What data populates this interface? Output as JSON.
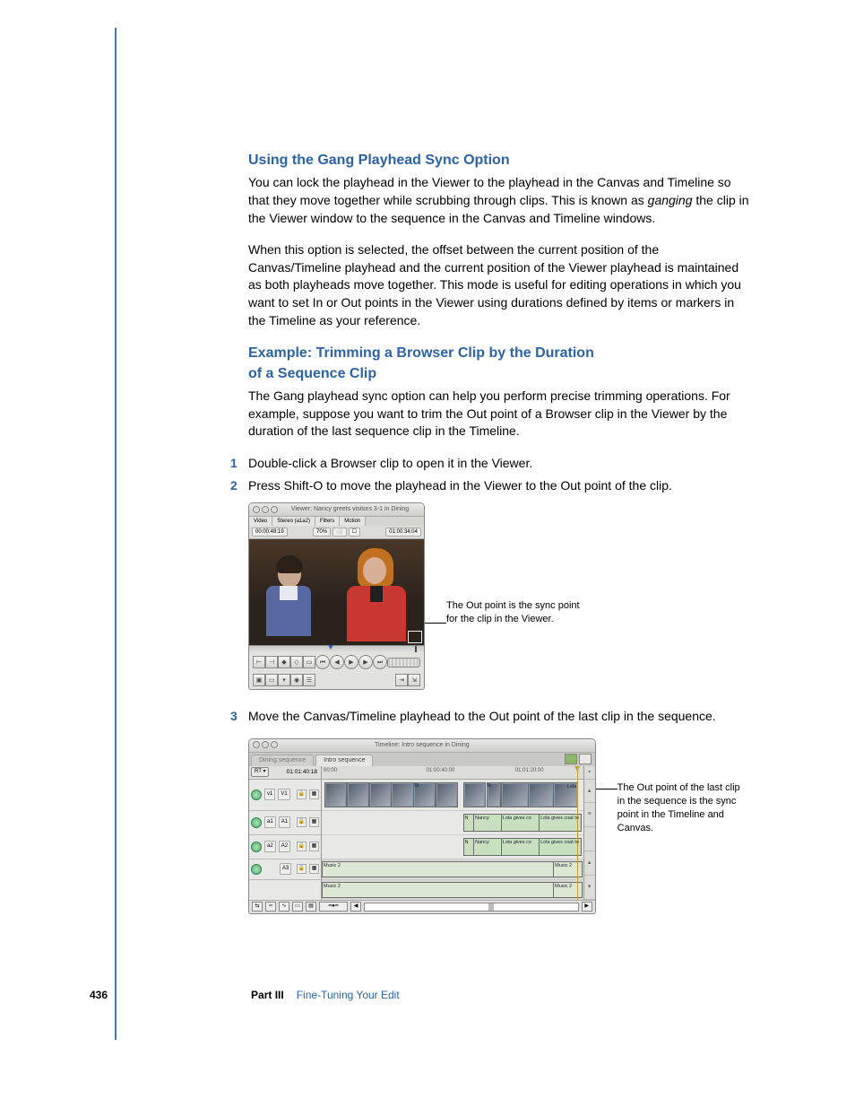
{
  "headings": {
    "h1": "Using the Gang Playhead Sync Option",
    "h2_line1": "Example:  Trimming a Browser Clip by the Duration",
    "h2_line2": "of a Sequence Clip"
  },
  "paragraphs": {
    "p1a": "You can lock the playhead in the Viewer to the playhead in the Canvas and Timeline so that they move together while scrubbing through clips. This is known as ",
    "p1_italic": "ganging",
    "p1b": " the clip in the Viewer window to the sequence in the Canvas and Timeline windows.",
    "p2": "When this option is selected, the offset between the current position of the Canvas/Timeline playhead and the current position of the Viewer playhead is maintained as both playheads move together. This mode is useful for editing operations in which you want to set In or Out points in the Viewer using durations defined by items or markers in the Timeline as your reference.",
    "p3": "The Gang playhead sync option can help you perform precise trimming operations. For example, suppose you want to trim the Out point of a Browser clip in the Viewer by the duration of the last sequence clip in the Timeline."
  },
  "steps": {
    "s1": "Double-click a Browser clip to open it in the Viewer.",
    "s2": "Press Shift-O to move the playhead in the Viewer to the Out point of the clip.",
    "s3": "Move the Canvas/Timeline playhead to the Out point of the last clip in the sequence."
  },
  "annotations": {
    "a1": "The Out point is the sync point for the clip in the Viewer.",
    "a2": "The Out point of the last clip in the sequence is the sync point in the Timeline and Canvas."
  },
  "viewer": {
    "title": "Viewer: Nancy greets visitors 3-1 in Dining",
    "tabs": [
      "Video",
      "Stereo (a1a2)",
      "Filters",
      "Motion"
    ],
    "tc_left": "00:00:48:19",
    "tc_right": "01:00:34:04",
    "popup1": "70%",
    "popup2": "⬜",
    "popup3": "☐"
  },
  "timeline": {
    "title": "Timeline: Intro sequence in Dining",
    "tabs": [
      "Dining sequence",
      "Intro sequence"
    ],
    "rt": "RT ▾",
    "tc": "01:01:40:18",
    "ruler": [
      "00:00",
      "01:00:40:00",
      "01:01:20:00"
    ],
    "tracks": {
      "v1": {
        "src": "v1",
        "dst": "V1"
      },
      "a1": {
        "src": "a1",
        "dst": "A1"
      },
      "a2": {
        "src": "a2",
        "dst": "A2"
      },
      "a3": {
        "src": "",
        "dst": "A3"
      }
    },
    "clips": {
      "nancy": "Nancy",
      "lola_gives": "Lola gives co",
      "lola_coat": "Lola gives coat to",
      "music": "Music 2",
      "lola": "Lola",
      "di": "Di",
      "n": "N"
    }
  },
  "footer": {
    "page": "436",
    "part": "Part III",
    "title": "Fine-Tuning Your Edit"
  }
}
